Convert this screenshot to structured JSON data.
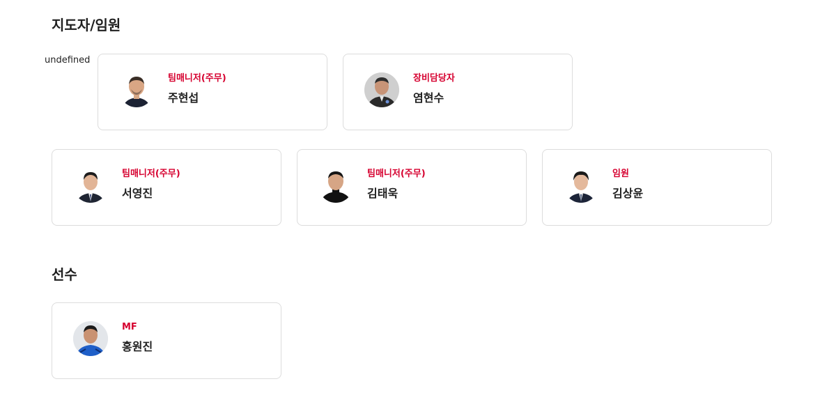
{
  "sections": {
    "staff_title": "지도자/임원",
    "players_title": "선수"
  },
  "stray_label": "undefined",
  "staff": [
    {
      "role": "팀매니저(주무)",
      "name": "주현섭"
    },
    {
      "role": "장비담당자",
      "name": "염현수"
    },
    {
      "role": "팀매니저(주무)",
      "name": "서영진"
    },
    {
      "role": "팀매니저(주무)",
      "name": "김태욱"
    },
    {
      "role": "임원",
      "name": "김상윤"
    }
  ],
  "players": [
    {
      "role": "MF",
      "name": "홍원진"
    }
  ],
  "colors": {
    "role_accent": "#d6002f",
    "card_border": "#dcdcdc",
    "text": "#1f1f1f"
  }
}
